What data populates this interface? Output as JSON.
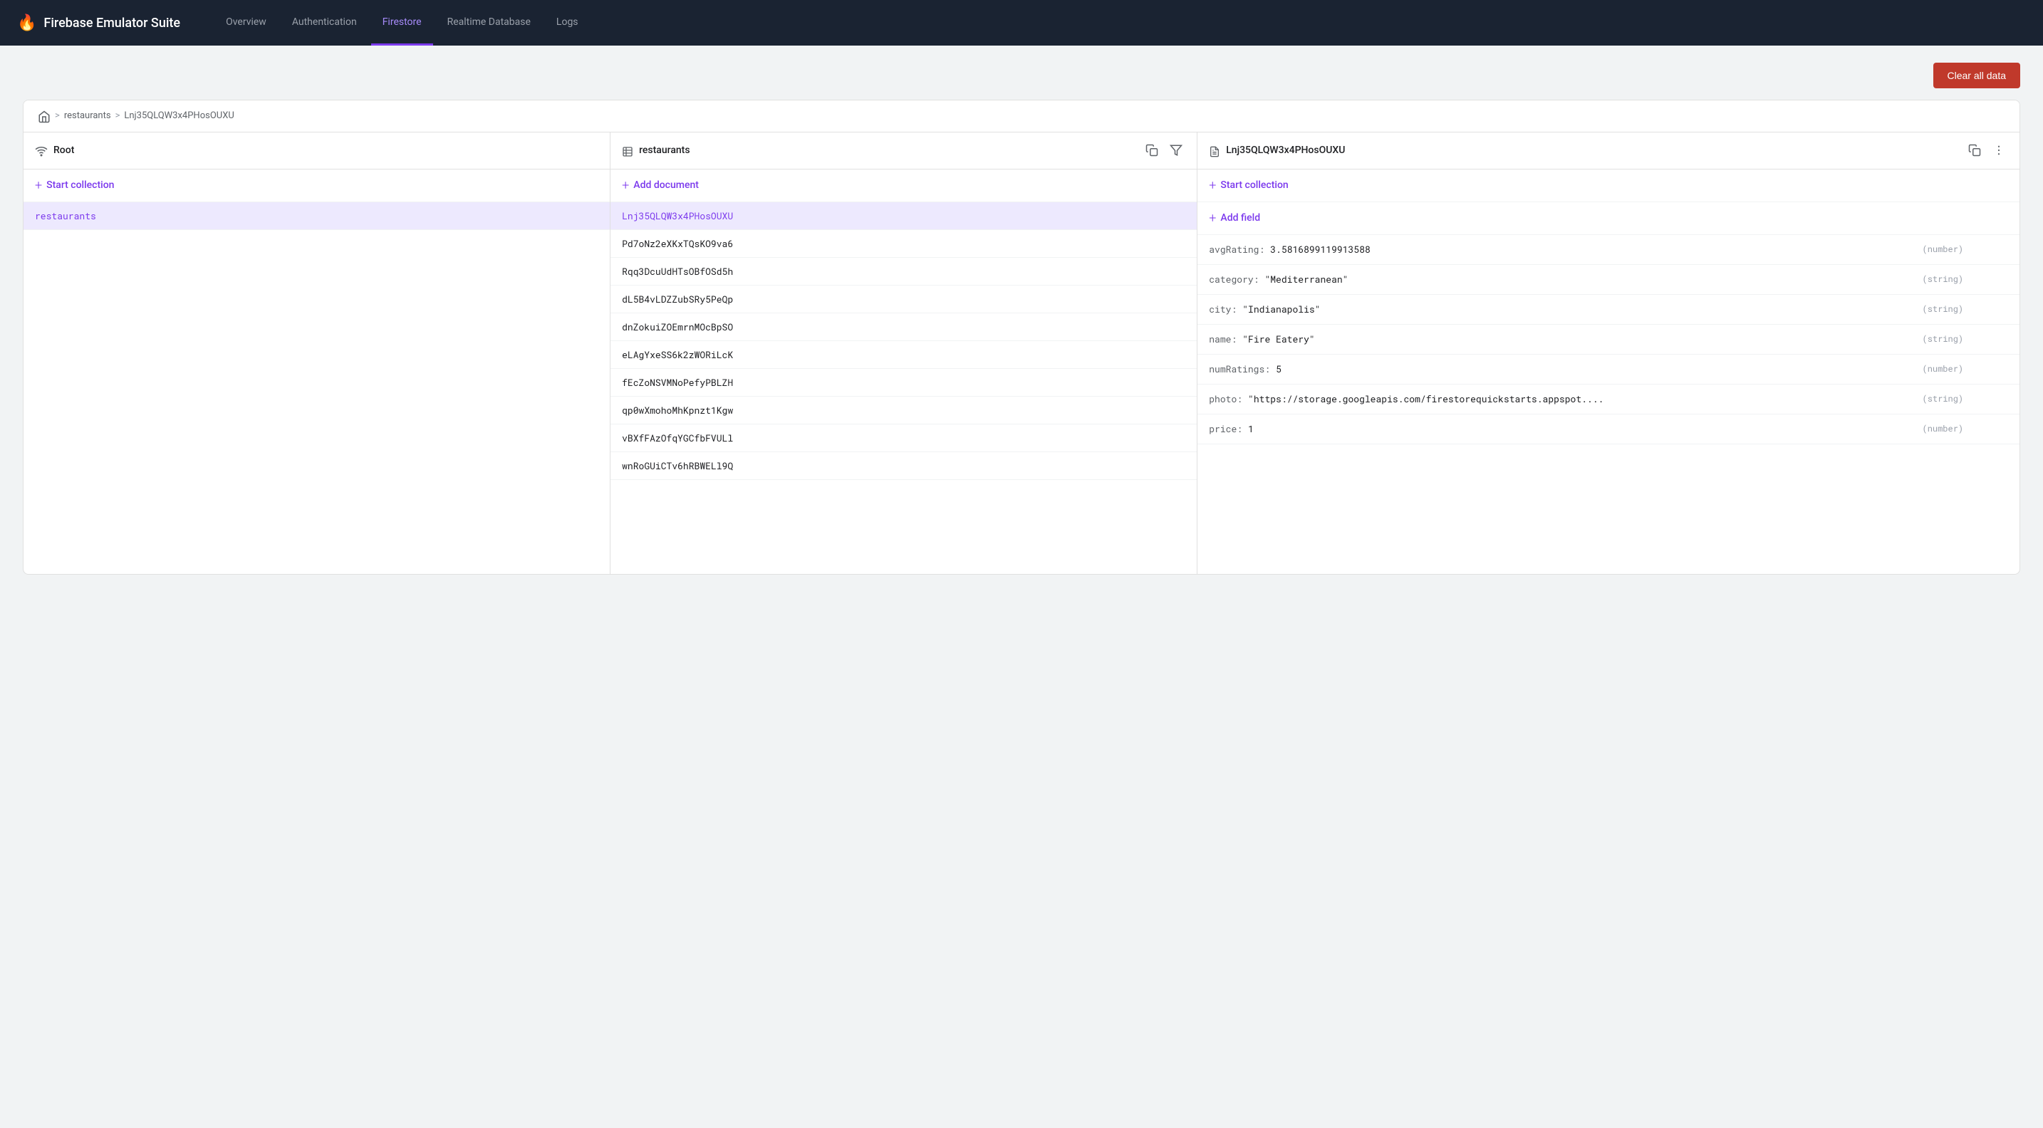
{
  "brand": {
    "name": "Firebase Emulator Suite"
  },
  "nav": {
    "items": [
      {
        "id": "overview",
        "label": "Overview",
        "active": false
      },
      {
        "id": "authentication",
        "label": "Authentication",
        "active": false
      },
      {
        "id": "firestore",
        "label": "Firestore",
        "active": true
      },
      {
        "id": "realtime-database",
        "label": "Realtime Database",
        "active": false
      },
      {
        "id": "logs",
        "label": "Logs",
        "active": false
      }
    ]
  },
  "toolbar": {
    "clear_all_label": "Clear all data"
  },
  "breadcrumb": {
    "home_title": "home",
    "sep1": ">",
    "restaurants": "restaurants",
    "sep2": ">",
    "doc_id": "Lnj35QLQW3x4PHosOUXU"
  },
  "columns": {
    "root": {
      "title": "Root",
      "start_collection_label": "Start collection",
      "items": [
        {
          "id": "restaurants",
          "label": "restaurants",
          "selected": true
        }
      ]
    },
    "restaurants": {
      "title": "restaurants",
      "add_document_label": "Add document",
      "items": [
        {
          "id": "lnj",
          "label": "Lnj35QLQW3x4PHosOUXU",
          "selected": true
        },
        {
          "id": "pd7",
          "label": "Pd7oNz2eXKxTQsKO9va6",
          "selected": false
        },
        {
          "id": "rqq",
          "label": "Rqq3DcuUdHTsOBfOSd5h",
          "selected": false
        },
        {
          "id": "dl5",
          "label": "dL5B4vLDZZubSRy5PeQp",
          "selected": false
        },
        {
          "id": "dnz",
          "label": "dnZokuiZOEmrnMOcBpSO",
          "selected": false
        },
        {
          "id": "ela",
          "label": "eLAgYxeSS6k2zWORiLcK",
          "selected": false
        },
        {
          "id": "fec",
          "label": "fEcZoNSVMNoPefyPBLZH",
          "selected": false
        },
        {
          "id": "qp0",
          "label": "qp0wXmohoMhKpnzt1Kgw",
          "selected": false
        },
        {
          "id": "vbx",
          "label": "vBXfFAzOfqYGCfbFVULl",
          "selected": false
        },
        {
          "id": "wnr",
          "label": "wnRoGUiCTv6hRBWELl9Q",
          "selected": false
        }
      ]
    },
    "document": {
      "title": "Lnj35QLQW3x4PHosOUXU",
      "start_collection_label": "Start collection",
      "add_field_label": "Add field",
      "fields": [
        {
          "key": "avgRating:",
          "value": "3.5816899119913588",
          "type": "(number)"
        },
        {
          "key": "category:",
          "value": "\"Mediterranean\"",
          "type": "(string)"
        },
        {
          "key": "city:",
          "value": "\"Indianapolis\"",
          "type": "(string)"
        },
        {
          "key": "name:",
          "value": "\"Fire Eatery\"",
          "type": "(string)"
        },
        {
          "key": "numRatings:",
          "value": "5",
          "type": "(number)"
        },
        {
          "key": "photo:",
          "value": "\"https://storage.googleapis.com/firestorequickstarts.appspot....",
          "type": "(string)"
        },
        {
          "key": "price:",
          "value": "1",
          "type": "(number)"
        }
      ]
    }
  }
}
